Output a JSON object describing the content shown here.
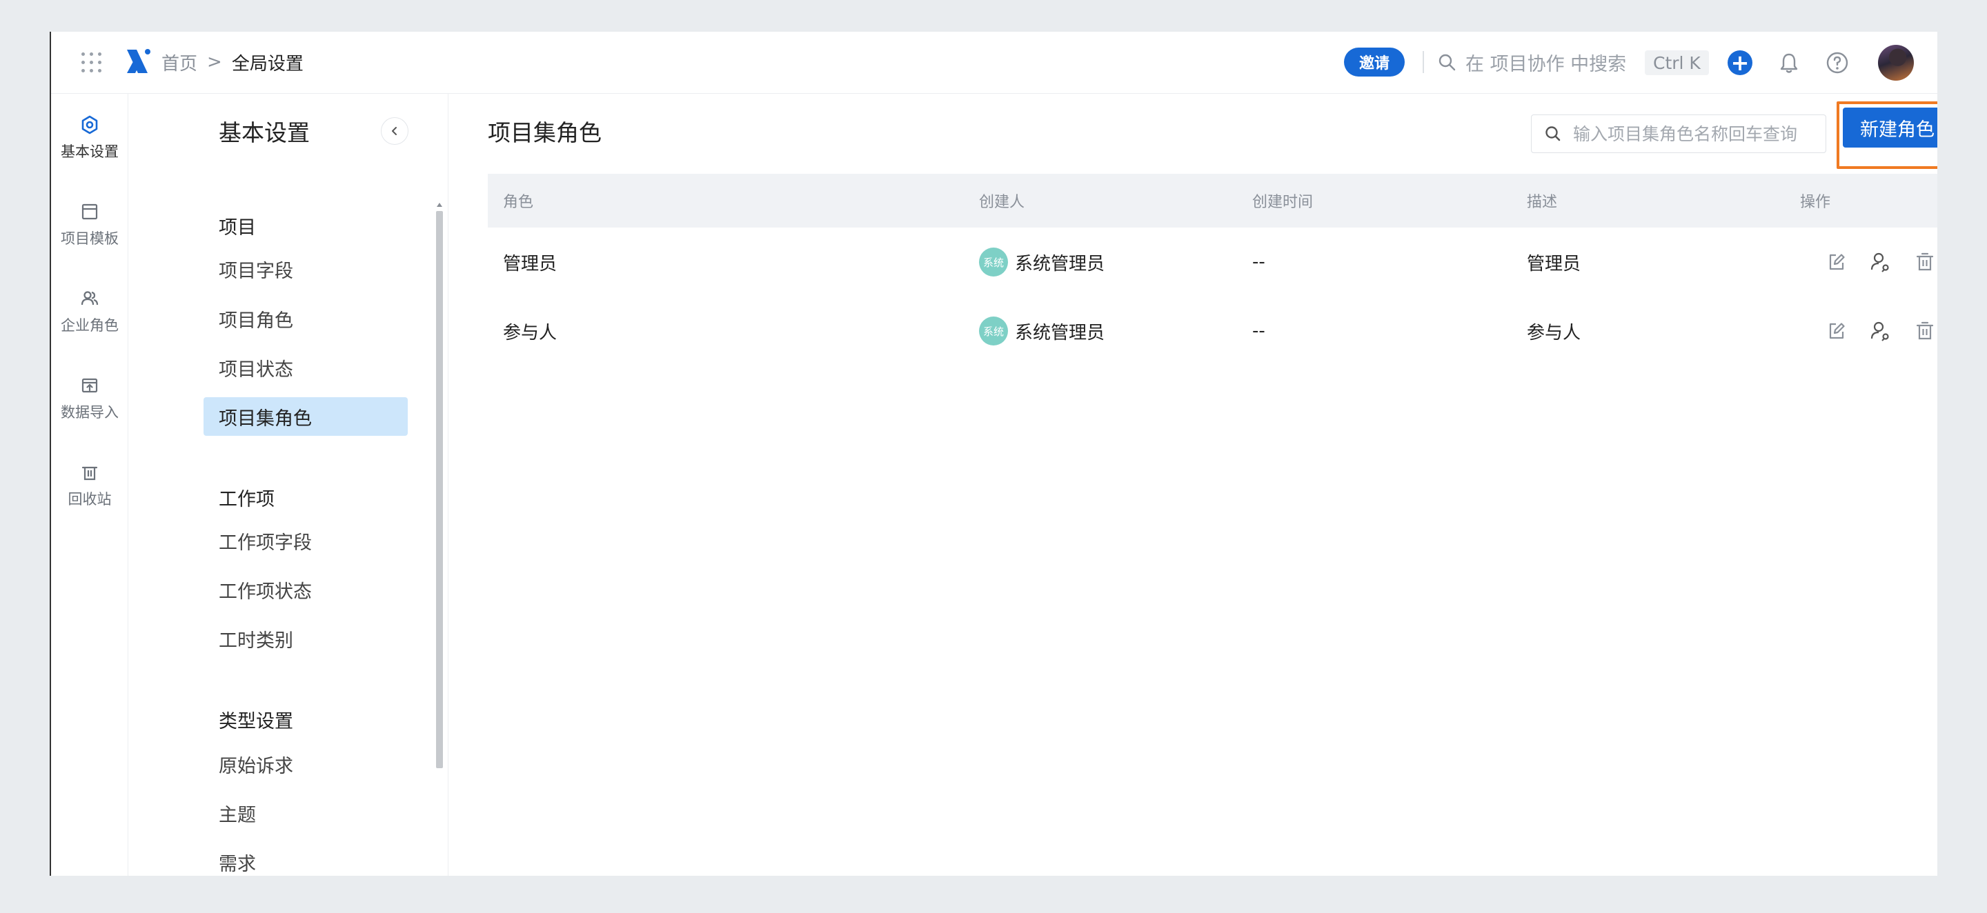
{
  "topbar": {
    "breadcrumb_home": "首页",
    "breadcrumb_sep": ">",
    "breadcrumb_current": "全局设置",
    "invite_label": "邀请",
    "search_placeholder": "在 项目协作 中搜索",
    "shortcut": "Ctrl K",
    "plus": "+",
    "accent_color": "#1769d6"
  },
  "rail": {
    "items": [
      {
        "label": "基本设置",
        "icon": "settings-hex-icon"
      },
      {
        "label": "项目模板",
        "icon": "template-icon"
      },
      {
        "label": "企业角色",
        "icon": "users-icon"
      },
      {
        "label": "数据导入",
        "icon": "import-icon"
      },
      {
        "label": "回收站",
        "icon": "trash-icon"
      }
    ]
  },
  "sidebar": {
    "title": "基本设置",
    "sections": [
      {
        "title": "项目",
        "items": [
          "项目字段",
          "项目角色",
          "项目状态",
          "项目集角色"
        ]
      },
      {
        "title": "工作项",
        "items": [
          "工作项字段",
          "工作项状态",
          "工时类别"
        ]
      },
      {
        "title": "类型设置",
        "items": [
          "原始诉求",
          "主题",
          "需求"
        ]
      }
    ],
    "active_item": "项目集角色",
    "active_color": "#cde6fb"
  },
  "main": {
    "title": "项目集角色",
    "search_placeholder": "输入项目集角色名称回车查询",
    "new_button_label": "新建角色",
    "highlight_color": "#f07a22"
  },
  "table": {
    "headers": [
      "角色",
      "创建人",
      "创建时间",
      "描述",
      "操作"
    ],
    "rows": [
      {
        "role": "管理员",
        "creator_avatar": "系统",
        "creator": "系统管理员",
        "created": "--",
        "desc": "管理员"
      },
      {
        "role": "参与人",
        "creator_avatar": "系统",
        "creator": "系统管理员",
        "created": "--",
        "desc": "参与人"
      }
    ]
  }
}
